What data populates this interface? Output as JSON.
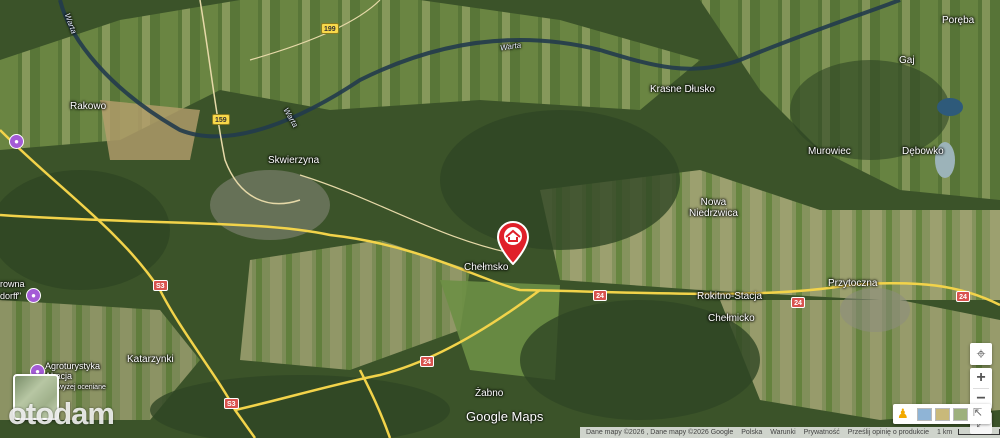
{
  "map": {
    "labels": {
      "rakowo": "Rakowo",
      "skwierzyna": "Skwierzyna",
      "chelmsko": "Chełmsko",
      "katarzynki": "Katarzynki",
      "zabno": "Żabno",
      "krasne_dlusko": "Krasne Dłusko",
      "nowa_niedrzwica": "Nowa\nNiedrzwica",
      "rokitno_stacja": "Rokitno-Stacja",
      "chelmicko": "Chełmicko",
      "murowiec": "Murowiec",
      "debowko": "Dębowko",
      "przytoczna": "Przytoczna",
      "poreba": "Poręba",
      "gaj": "Gaj",
      "warta_1": "Warta",
      "warta_2": "Warta",
      "warta_3": "Warta",
      "agroturystyka": "Agroturystyka\nAkacja",
      "agro_rating": "wyżej oceniane",
      "rowna": "rowna",
      "dorff": "dorff\""
    },
    "roads": {
      "r199": "199",
      "r159": "159",
      "s3a": "S3",
      "s3b": "S3",
      "r24a": "24",
      "r24b": "24",
      "r24c": "24",
      "r24d": "24",
      "r24e": "24"
    },
    "pin_icon": "property-marker-icon"
  },
  "controls": {
    "zoom_in": "+",
    "zoom_out": "−"
  },
  "branding": {
    "site_logo": "otodam",
    "google_logo": "Google Maps"
  },
  "footer": {
    "map_data": "Dane mapy ©2026 , Dane mapy ©2026 Google",
    "country": "Polska",
    "terms": "Warunki",
    "privacy": "Prywatność",
    "feedback": "Prześlij opinię o produkcie",
    "scale": "1 km"
  },
  "colors": {
    "pin": "#e0202a",
    "road_major": "#f2d34a",
    "poi": "#a45bd6"
  }
}
